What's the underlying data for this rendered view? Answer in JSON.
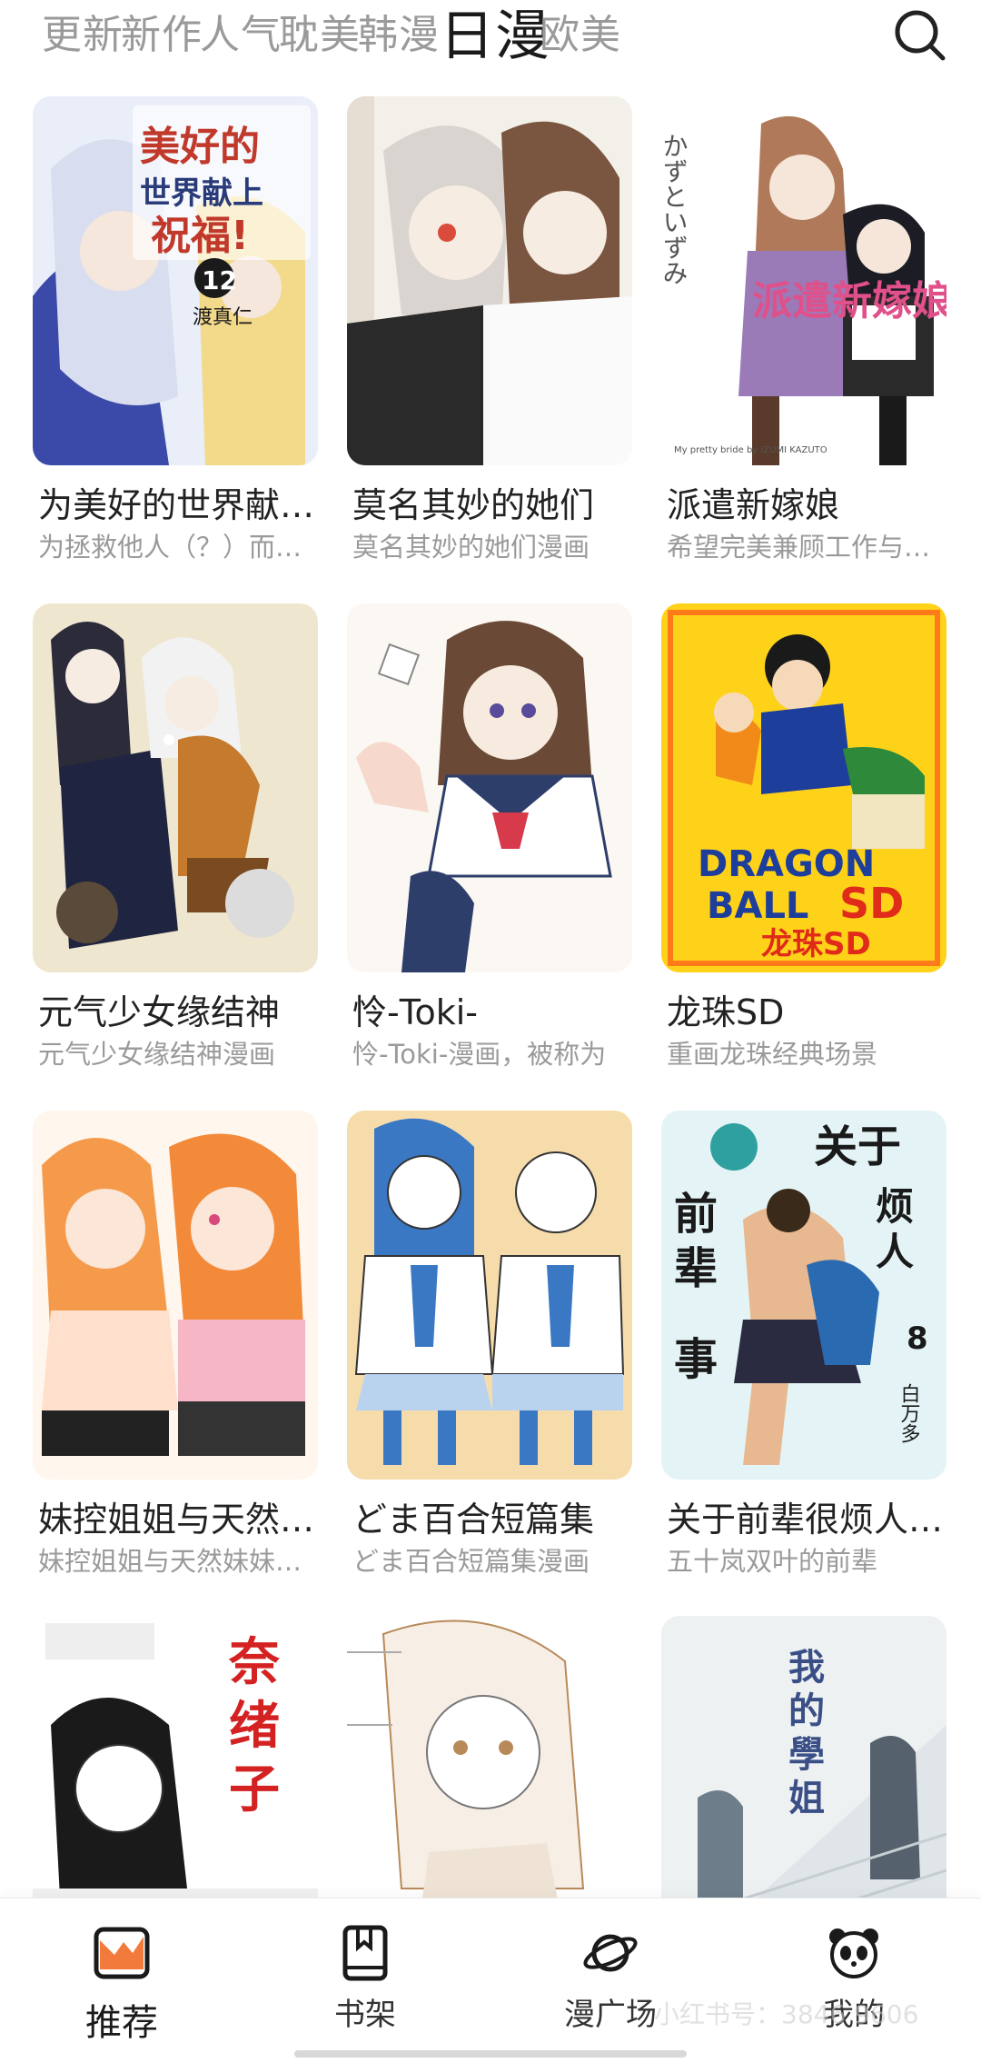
{
  "top_tabs": [
    {
      "label": "更新"
    },
    {
      "label": "新作"
    },
    {
      "label": "人气"
    },
    {
      "label": "耽美"
    },
    {
      "label": "韩漫"
    },
    {
      "label": "日漫",
      "active": true
    },
    {
      "label": "欧美"
    }
  ],
  "search": {
    "icon": "search-icon"
  },
  "comics": [
    {
      "title": "为美好的世界献上祝福！",
      "desc": "为拯救他人（？）而死去的少年",
      "cover_text": "为美好的世界献上祝福！",
      "cover_sub": "12",
      "cover_author": "渡真仁",
      "cover_bg": "#e9eef8",
      "cover_accent": "#c0392b"
    },
    {
      "title": "莫名其妙的她们",
      "desc": "莫名其妙的她们漫画",
      "cover_text": "",
      "cover_sub": "",
      "cover_author": "",
      "cover_bg": "#f3efe9",
      "cover_accent": "#8a6a52"
    },
    {
      "title": "派遣新嫁娘",
      "desc": "希望完美兼顾工作与家庭",
      "cover_text": "派遣新嫁娘",
      "cover_sub": "かずといずみ",
      "cover_author": "My pretty bride by IZUMI KAZUTO",
      "cover_bg": "#ffffff",
      "cover_accent": "#e0508a"
    },
    {
      "title": "元气少女缘结神",
      "desc": "元气少女缘结神漫画",
      "cover_text": "",
      "cover_sub": "",
      "cover_author": "",
      "cover_bg": "#efe6cf",
      "cover_accent": "#d38a2a"
    },
    {
      "title": "怜-Toki-",
      "desc": "怜-Toki-漫画，被称为",
      "cover_text": "",
      "cover_sub": "",
      "cover_author": "",
      "cover_bg": "#fbf7f2",
      "cover_accent": "#2d3e6a"
    },
    {
      "title": "龙珠SD",
      "desc": "重画龙珠经典场景",
      "cover_text": "DRAGON BALL SD",
      "cover_sub": "龙珠SD",
      "cover_author": "",
      "cover_bg": "#ffd21a",
      "cover_accent": "#1d3e9a"
    },
    {
      "title": "妹控姐姐与天然妹妹",
      "desc": "妹控姐姐与天然妹妹漫画",
      "cover_text": "",
      "cover_sub": "",
      "cover_author": "",
      "cover_bg": "#fff6ee",
      "cover_accent": "#f28a3a"
    },
    {
      "title": "どま百合短篇集",
      "desc": "どま百合短篇集漫画",
      "cover_text": "",
      "cover_sub": "",
      "cover_author": "",
      "cover_bg": "#f7dcab",
      "cover_accent": "#3a78c4"
    },
    {
      "title": "关于前辈很烦人的事",
      "desc": "五十岚双叶的前辈",
      "cover_text": "关于前辈很烦人的事",
      "cover_sub": "8",
      "cover_author": "白万多",
      "cover_bg": "#e4f4f6",
      "cover_accent": "#2a2a2a"
    },
    {
      "title": "",
      "desc": "",
      "cover_text": "奈绪子",
      "cover_sub": "",
      "cover_author": "",
      "cover_bg": "#ffffff",
      "cover_accent": "#d42222"
    },
    {
      "title": "",
      "desc": "",
      "cover_text": "",
      "cover_sub": "",
      "cover_author": "",
      "cover_bg": "#ffffff",
      "cover_accent": "#b88a5a"
    },
    {
      "title": "",
      "desc": "",
      "cover_text": "我的學姐",
      "cover_sub": "",
      "cover_author": "",
      "cover_bg": "#eef1f2",
      "cover_accent": "#3a4f86"
    }
  ],
  "bottom_nav": [
    {
      "label": "推荐",
      "icon": "recommend-icon",
      "active": true
    },
    {
      "label": "书架",
      "icon": "bookshelf-icon"
    },
    {
      "label": "漫广场",
      "icon": "planet-icon"
    },
    {
      "label": "我的",
      "icon": "panda-icon"
    }
  ],
  "watermark": "小红书号：3846 9606"
}
